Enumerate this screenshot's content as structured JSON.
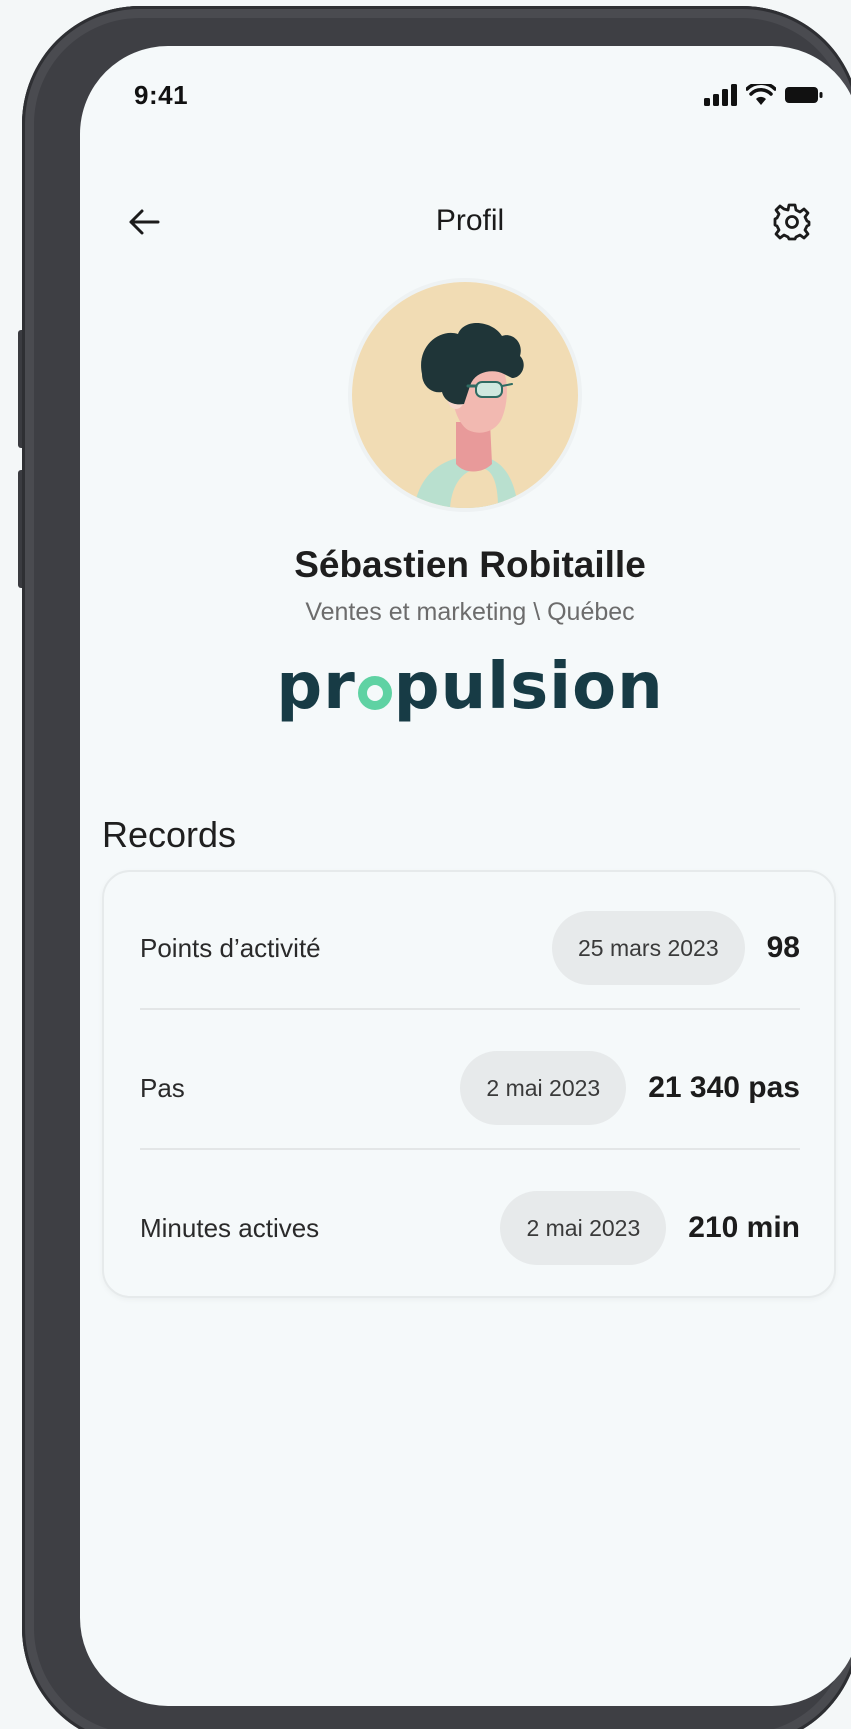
{
  "status_bar": {
    "time": "9:41"
  },
  "header": {
    "title": "Profil",
    "back_icon": "arrow-left-icon",
    "settings_icon": "gear-icon"
  },
  "profile": {
    "name": "Sébastien Robitaille",
    "department": "Ventes et marketing \\ Québec",
    "avatar_icon": "avatar-illustration"
  },
  "brand": {
    "name": "propulsion",
    "pre": "pr",
    "post": "pulsion",
    "colors": {
      "primary": "#173b45",
      "accent": "#5fd2a3"
    }
  },
  "records": {
    "title": "Records",
    "items": [
      {
        "label": "Points d’activité",
        "date": "25 mars 2023",
        "value": "98"
      },
      {
        "label": "Pas",
        "date": "2 mai 2023",
        "value": "21 340 pas"
      },
      {
        "label": "Minutes actives",
        "date": "2 mai 2023",
        "value": "210 min"
      }
    ]
  }
}
